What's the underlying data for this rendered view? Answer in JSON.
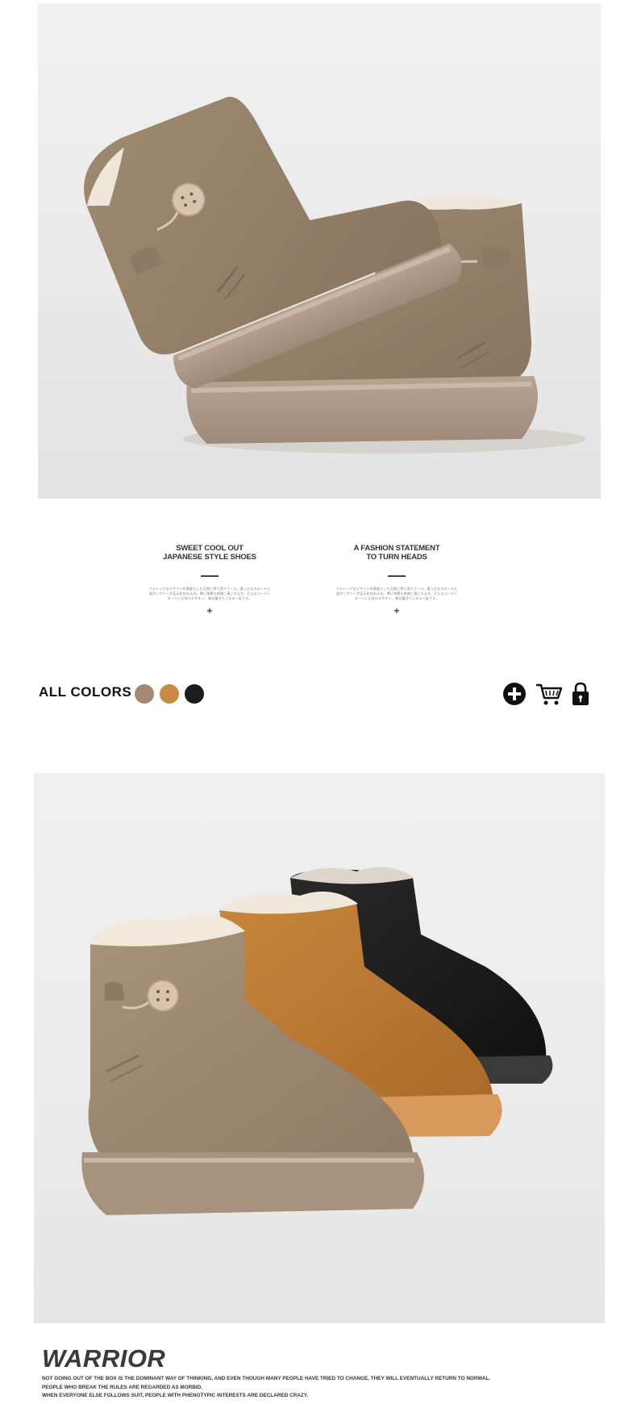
{
  "features": [
    {
      "title_line1": "SWEET COOL OUT",
      "title_line2": "JAPANESE STYLE SHOES",
      "body": "クラシックなデザインを基調とした日常に寄り添うブーツ。柔らかなスエードと温かいファーが足元を包み込み、寒い季節も快適に過ごせます。どんなコーディネートにも合わせやすく、毎日履きたくなる一足です。",
      "plus": "+"
    },
    {
      "title_line1": "A FASHION STATEMENT",
      "title_line2": "TO TURN HEADS",
      "body": "クラシックなデザインを基調とした日常に寄り添うブーツ。柔らかなスエードと温かいファーが足元を包み込み、寒い季節も快適に過ごせます。どんなコーディネートにも合わせやすく、毎日履きたくなる一足です。",
      "plus": "+"
    }
  ],
  "colors": {
    "label": "ALL COLORS",
    "swatches": [
      {
        "name": "khaki",
        "hex": "#a48a72"
      },
      {
        "name": "tan",
        "hex": "#c98a44"
      },
      {
        "name": "black",
        "hex": "#1c1c1c"
      }
    ]
  },
  "actions": {
    "add_icon": "plus-circle-icon",
    "cart_icon": "shopping-cart-icon",
    "lock_icon": "lock-icon"
  },
  "brand": {
    "title": "WARRIOR",
    "lines": [
      "NOT GOING OUT OF THE BOX IS THE DOMINANT WAY OF THINKING, AND EVEN THOUGH MANY PEOPLE HAVE TRIED TO CHANGE, THEY WILL EVENTUALLY RETURN TO NORMAL.",
      "PEOPLE WHO BREAK THE RULES ARE REGARDED AS MORBID.",
      "WHEN EVERYONE ELSE FOLLOWS SUIT, PEOPLE WITH PHENOTYPIC INTERESTS ARE DECLARED CRAZY."
    ]
  }
}
